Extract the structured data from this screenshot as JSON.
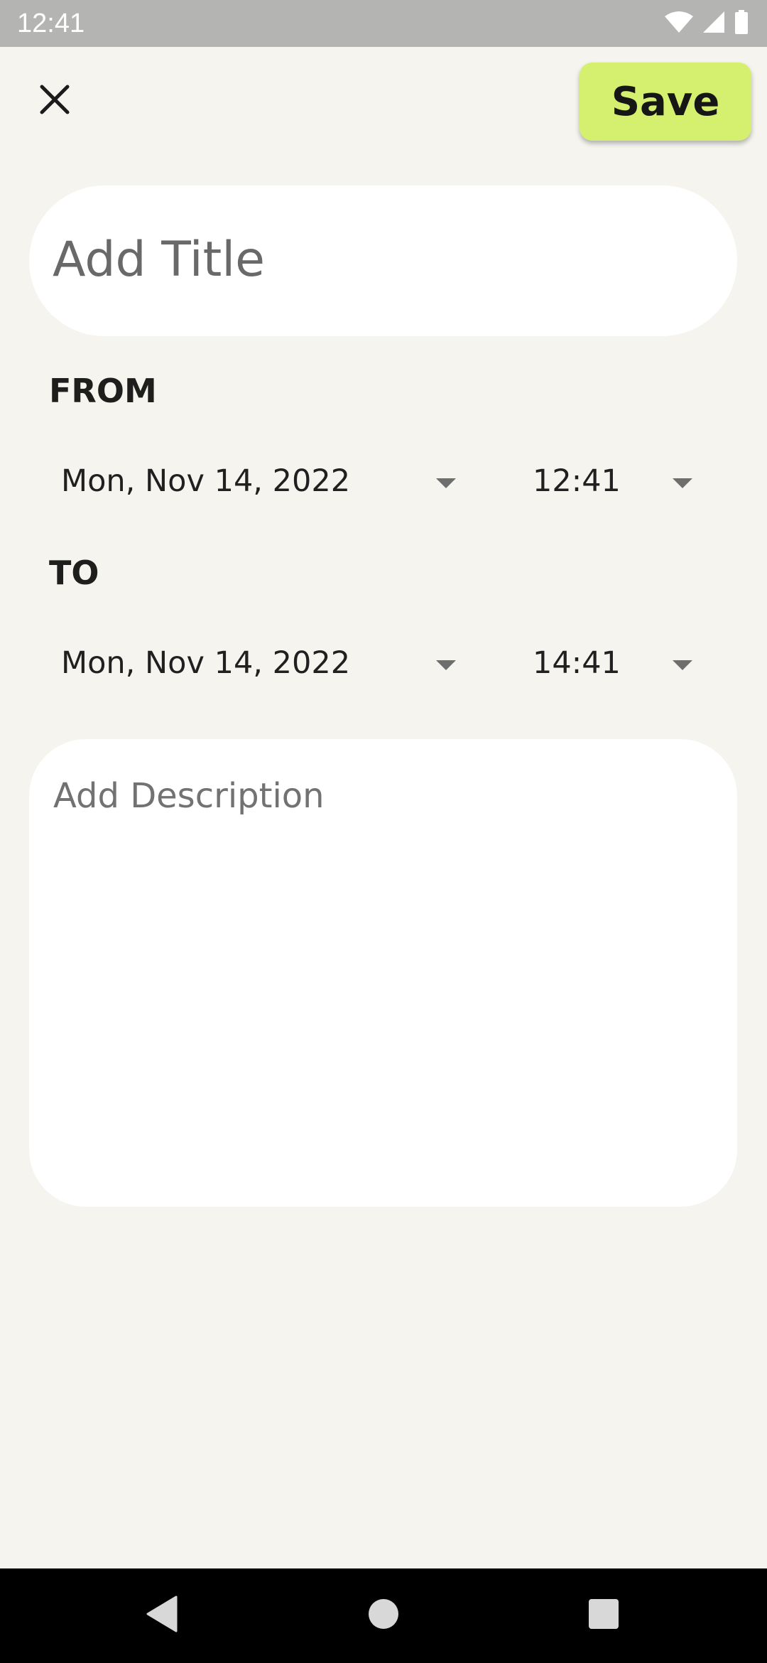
{
  "status_bar": {
    "time": "12:41",
    "icons": [
      "wifi-icon",
      "cellular-signal-icon",
      "battery-icon"
    ]
  },
  "toolbar": {
    "close_icon": "close-icon",
    "save_label": "Save"
  },
  "title_field": {
    "placeholder": "Add Title",
    "value": ""
  },
  "from": {
    "label": "FROM",
    "date": "Mon, Nov 14, 2022",
    "time": "12:41"
  },
  "to": {
    "label": "TO",
    "date": "Mon, Nov 14, 2022",
    "time": "14:41"
  },
  "description_field": {
    "placeholder": "Add Description",
    "value": ""
  },
  "nav_bar": {
    "buttons": [
      "back-icon",
      "home-icon",
      "recents-icon"
    ]
  },
  "colors": {
    "background": "#f5f4ef",
    "accent": "#d4f06e",
    "card": "#ffffff",
    "status_bar": "#b4b4b2"
  }
}
